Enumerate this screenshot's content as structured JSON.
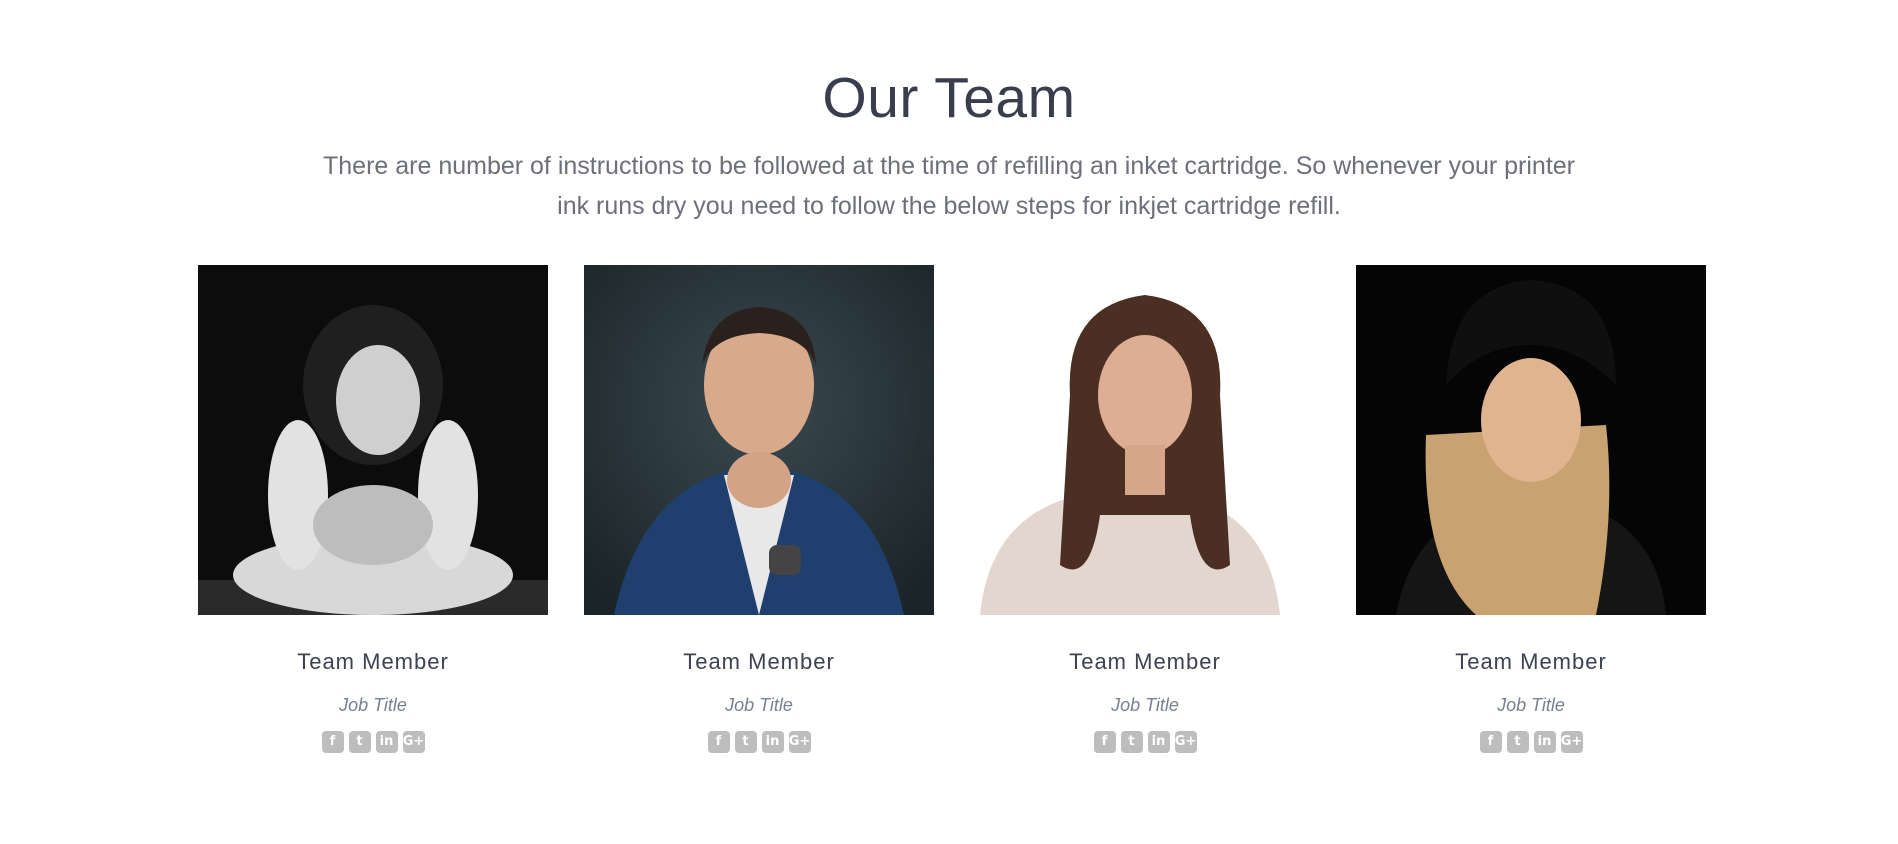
{
  "section": {
    "title": "Our Team",
    "description": "There are number of instructions to be followed at the time of refilling an inket cartridge. So whenever your printer ink runs dry you need to follow the below steps for inkjet cartridge refill."
  },
  "members": [
    {
      "name": "Team Member",
      "job_title": "Job Title",
      "photo": "woman-bw-portrait"
    },
    {
      "name": "Team Member",
      "job_title": "Job Title",
      "photo": "man-blue-suit-portrait"
    },
    {
      "name": "Team Member",
      "job_title": "Job Title",
      "photo": "woman-white-background-portrait"
    },
    {
      "name": "Team Member",
      "job_title": "Job Title",
      "photo": "woman-black-beanie-portrait"
    }
  ],
  "social_icons": [
    {
      "icon": "facebook-icon",
      "glyph": "f"
    },
    {
      "icon": "twitter-icon",
      "glyph": "t"
    },
    {
      "icon": "linkedin-icon",
      "glyph": "in"
    },
    {
      "icon": "google-plus-icon",
      "glyph": "G+"
    }
  ],
  "colors": {
    "heading": "#3a3d4e",
    "text": "#6d6f7a",
    "job_title": "#7a7f91",
    "social_bg": "#bdbdbd"
  }
}
